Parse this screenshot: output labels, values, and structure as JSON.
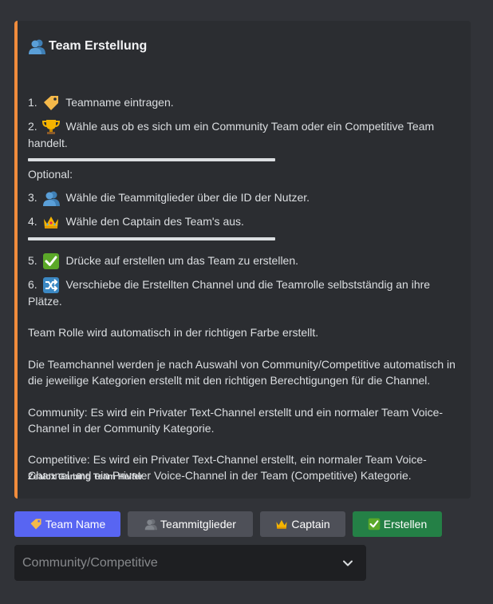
{
  "embed": {
    "accent_color": "#f08c3c",
    "title": "Team Erstellung",
    "title_icon": "busts-in-silhouette-icon",
    "steps_a": [
      {
        "num": "1.",
        "icon": "label-tag-icon",
        "text": "Teamname eintragen."
      },
      {
        "num": "2.",
        "icon": "trophy-icon",
        "text": "Wähle aus ob es sich um ein Community Team oder ein Competitive Team handelt."
      }
    ],
    "optional_label": "Optional:",
    "steps_b": [
      {
        "num": "3.",
        "icon": "busts-in-silhouette-icon",
        "text": "Wähle die Teammitglieder über die ID der Nutzer."
      },
      {
        "num": "4.",
        "icon": "crown-icon",
        "text": "Wähle den Captain des Team's aus."
      }
    ],
    "steps_c": [
      {
        "num": "5.",
        "icon": "check-mark-button-icon",
        "text": "Drücke auf erstellen um das Team zu erstellen."
      },
      {
        "num": "6.",
        "icon": "shuffle-icon",
        "text": "Verschiebe die Erstellten Channel und die Teamrolle selbstständig an ihre Plätze."
      }
    ],
    "paragraphs": [
      "Team Rolle wird automatisch in der richtigen Farbe erstellt.",
      "Die Teamchannel werden je nach Auswahl von Community/Competitive automatisch in die jeweilige Kategorien erstellt mit den richtigen Berechtigungen für die Channel.",
      "Community: Es wird ein Privater Text-Channel erstellt und ein normaler Team Voice-Channel in der Community Kategorie.",
      "Competitive: Es wird ein Privater Text-Channel erstellt, ein normaler Team Voice-Channel und ein Privater Voice-Channel in der Team (Competitive) Kategorie."
    ],
    "footer": "Zealox Gaming Team Helfer"
  },
  "buttons": [
    {
      "label": "Team Name",
      "icon": "label-tag-icon",
      "style": "primary"
    },
    {
      "label": "Teammitglieder",
      "icon": "busts-in-silhouette-icon",
      "style": "secondary"
    },
    {
      "label": "Captain",
      "icon": "crown-icon",
      "style": "secondary"
    },
    {
      "label": "Erstellen",
      "icon": "check-mark-button-icon",
      "style": "success"
    }
  ],
  "select": {
    "placeholder": "Community/Competitive"
  },
  "colors": {
    "background": "#313338",
    "embed_bg": "#2b2d31",
    "primary": "#5865f2",
    "secondary": "#4e5058",
    "success": "#248046"
  }
}
